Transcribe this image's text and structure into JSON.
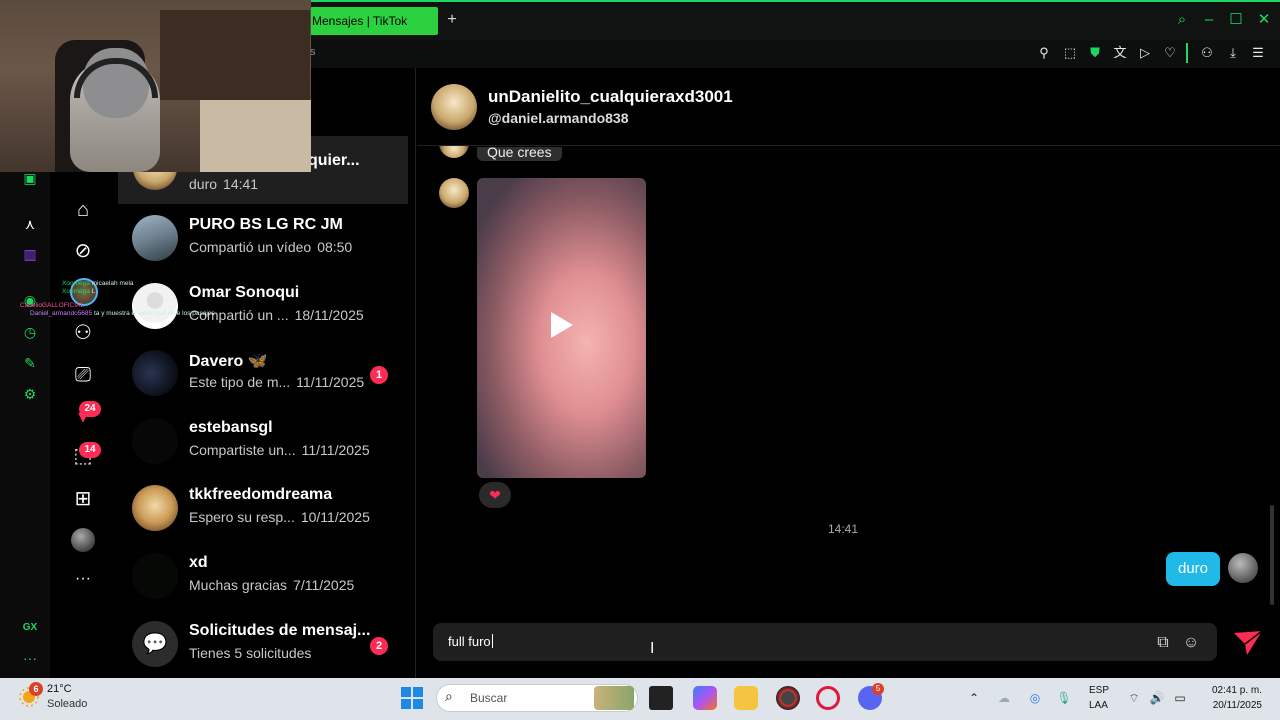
{
  "browser": {
    "tab_title": "Mensajes | TikTok",
    "new_tab": "+",
    "address_fragment": "s"
  },
  "opera_sidebar": {
    "counter_label": "GX"
  },
  "tiktok_nav": {
    "badge_messages": "24",
    "badge_inbox": "14",
    "more": "···"
  },
  "conversations": [
    {
      "name": "unDanielito_cualquierxd3001",
      "name_visible": "quier...",
      "preview": "duro",
      "time": "14:41",
      "badge": "",
      "selected": true
    },
    {
      "name": "PURO BS LG RC JM",
      "preview": "Compartió un vídeo",
      "time": "08:50",
      "badge": ""
    },
    {
      "name": "Omar Sonoqui",
      "preview": "Compartió un ...",
      "time": "18/11/2025",
      "badge": ""
    },
    {
      "name": "Davero 🦋",
      "preview": "Este tipo de m...",
      "time": "11/11/2025",
      "badge": "1"
    },
    {
      "name": "estebansgl",
      "preview": "Compartiste un...",
      "time": "11/11/2025",
      "badge": ""
    },
    {
      "name": "tkkfreedomdreama",
      "preview": "Espero su resp...",
      "time": "10/11/2025",
      "badge": ""
    },
    {
      "name": "xd",
      "preview": "Muchas gracias",
      "time": "7/11/2025",
      "badge": ""
    },
    {
      "name": "Solicitudes de mensaj...",
      "preview": "Tienes 5 solicitudes",
      "time": "",
      "badge": "2"
    }
  ],
  "chat": {
    "name": "unDanielito_cualquieraxd3001",
    "handle": "@daniel.armando838",
    "incoming_text": "Que crees",
    "reaction": "❤",
    "timestamp": "14:41",
    "outgoing_text": "duro",
    "composer_value": "full furo"
  },
  "stream_overlay": {
    "line1_user": "Xoomega",
    "line1_text": "micaelah mela",
    "line2_user": "Xoomega",
    "line2_text": "L",
    "line3_user": "CanelioGALLOFICIAL",
    "line4_user": "Daniel_armando5685",
    "line4_text": "ta y muestra el video que hice los pasajes"
  },
  "taskbar": {
    "weather_badge": "6",
    "temperature": "21°C",
    "condition": "Soleado",
    "search_placeholder": "Buscar",
    "discord_badge": "5",
    "lang_top": "ESP",
    "lang_bottom": "LAA",
    "time": "02:41 p. m.",
    "date": "20/11/2025"
  },
  "colors": {
    "accent_green": "#1ed760",
    "tiktok_red": "#fe2c55",
    "outgoing_bubble": "#20b9e8"
  }
}
